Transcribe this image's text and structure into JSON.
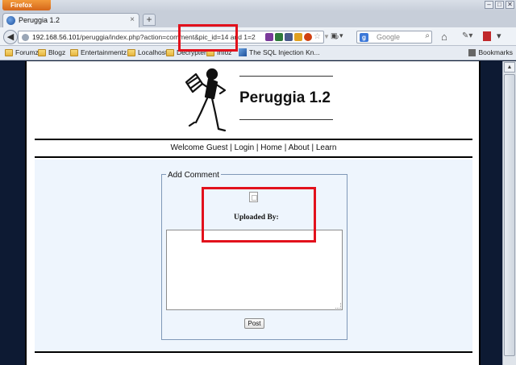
{
  "browser": {
    "menu_button": "Firefox",
    "tab_title": "Peruggia 1.2",
    "url_host": "192.168.56.101",
    "url_path": "/peruggia/index.php?action=comment&pic_id=14 and 1=2",
    "search_placeholder": "Google",
    "search_engine_letter": "g",
    "bookmarks": [
      "Forumz",
      "Blogz",
      "Entertainmentz",
      "Localhost",
      "Decrypter",
      "Infoz",
      "The SQL Injection Kn..."
    ],
    "bookmarks_menu": "Bookmarks"
  },
  "page": {
    "site_title": "Peruggia 1.2",
    "nav": {
      "welcome": "Welcome Guest",
      "separator": " | ",
      "login": "Login",
      "home": "Home",
      "about": "About",
      "learn": "Learn"
    },
    "form": {
      "legend": "Add Comment",
      "uploaded_by": "Uploaded By:",
      "comment_value": "",
      "post_label": "Post"
    }
  },
  "colors": {
    "highlight": "#e2111c",
    "page_background": "#0d1a33",
    "content_background": "#eef5fd"
  }
}
